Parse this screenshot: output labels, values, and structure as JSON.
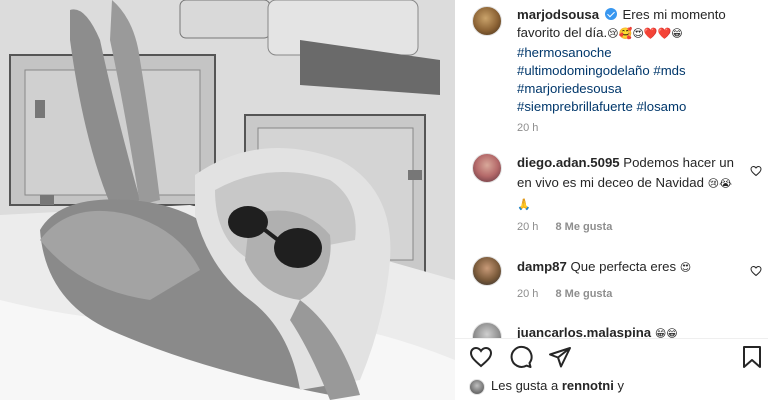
{
  "post": {
    "username": "marjodsousa",
    "caption_lines": [
      "Eres mi momento",
      "favorito del día."
    ],
    "caption_emojis": "😢🥰😍❤️❤️😁",
    "hashtags": [
      "#hermosanoche",
      "#ultimodomingodelaño #mds",
      "#marjoriedesousa",
      "#siemprebrillafuerte #losamo"
    ],
    "time": "20 h"
  },
  "comments": [
    {
      "username": "diego.adan.5095",
      "text": "Podemos hacer un en vivo es mi deceo de Navidad",
      "emojis": "😢😭🙏",
      "time": "20 h",
      "likes": "8 Me gusta"
    },
    {
      "username": "damp87",
      "text": "Que perfecta eres",
      "emojis": "😍",
      "time": "20 h",
      "likes": "8 Me gusta"
    },
    {
      "username": "juancarlos.malaspina",
      "text": "",
      "emojis": "😁😁",
      "time": "",
      "likes": ""
    }
  ],
  "likes_text": "Les gusta a",
  "likes_user": "rennotni",
  "likes_suffix": "y",
  "colors": {
    "link": "#00376b",
    "muted": "#8e8e8e",
    "verified": "#3897f0",
    "text": "#262626"
  },
  "icons": [
    "heart-icon",
    "comment-icon",
    "share-icon",
    "bookmark-icon",
    "verified-icon",
    "heart-outline-icon"
  ]
}
